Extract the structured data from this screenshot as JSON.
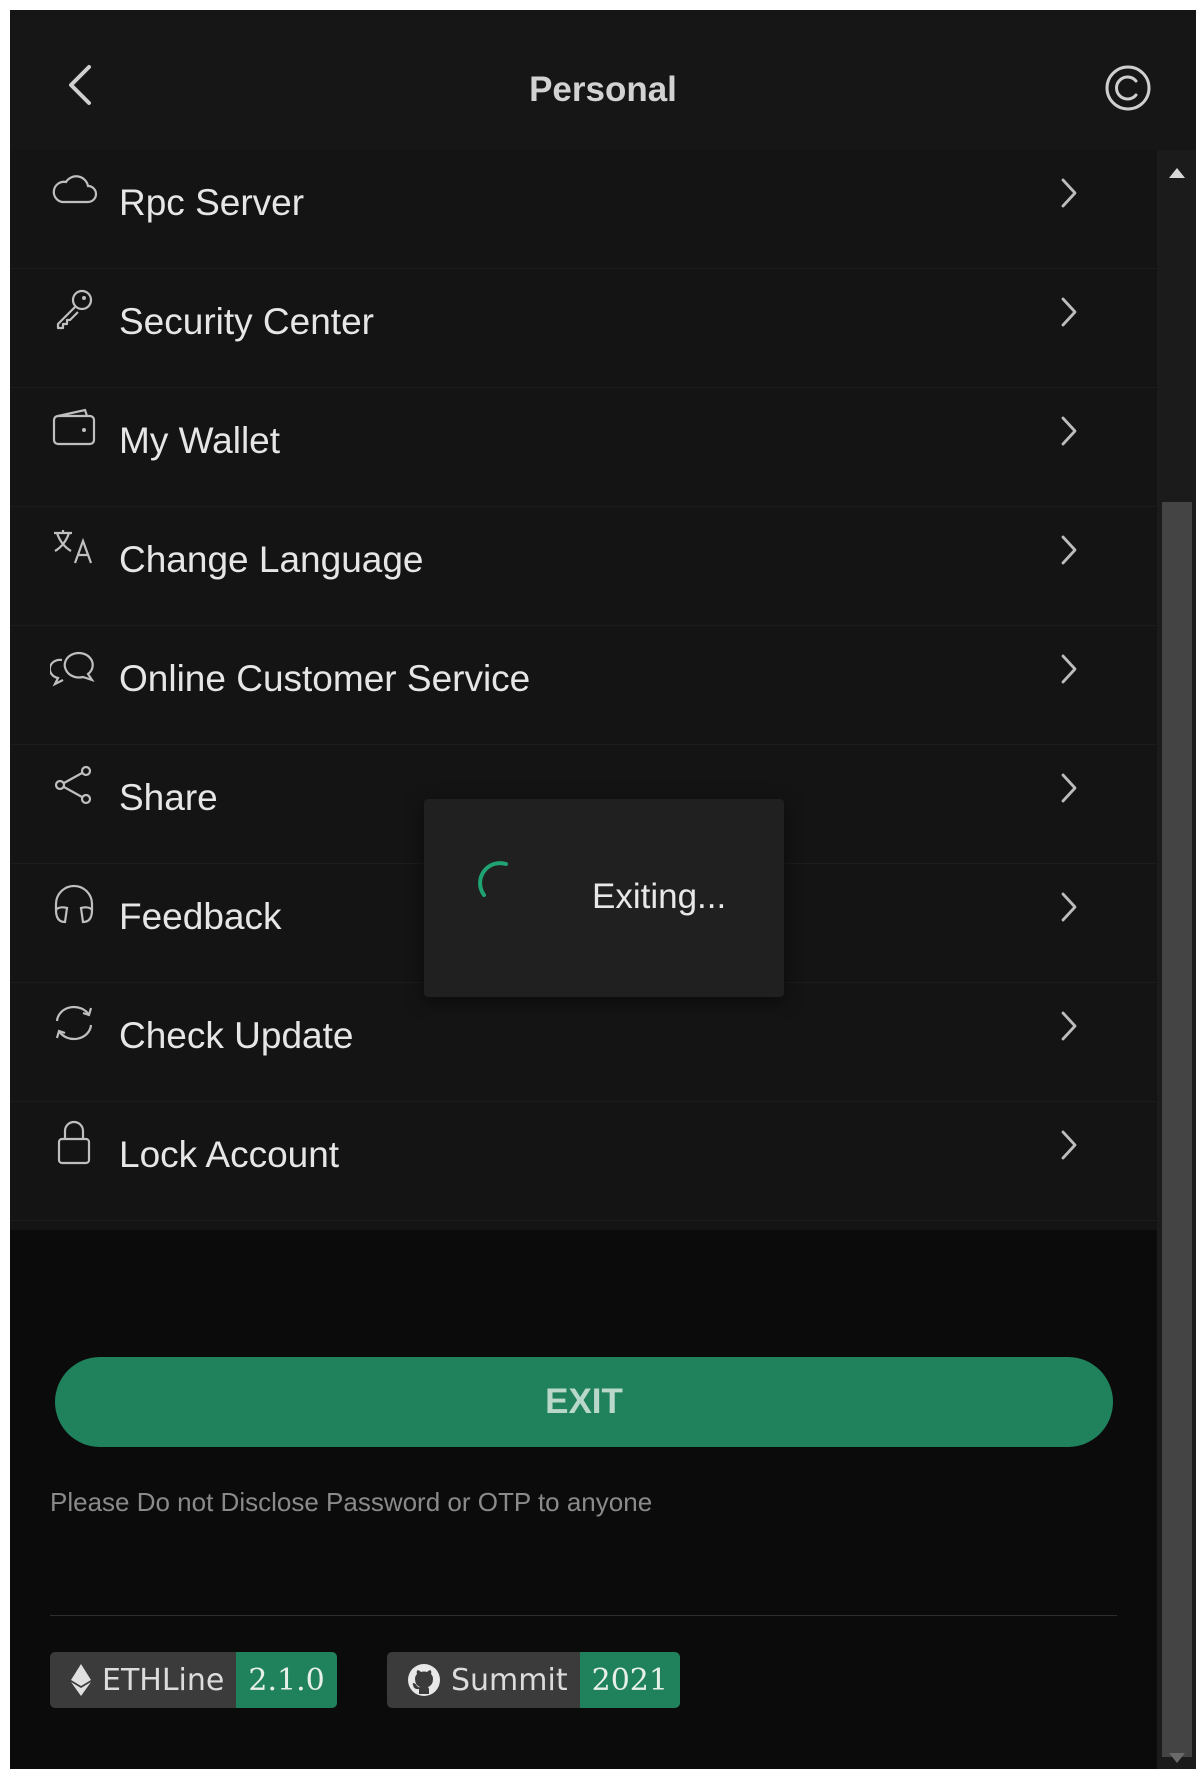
{
  "header": {
    "title": "Personal",
    "back_icon": "chevron-left-icon",
    "refresh_icon": "copyright-refresh-icon"
  },
  "menu": {
    "items": [
      {
        "label": "Rpc Server",
        "icon": "cloud-icon"
      },
      {
        "label": "Security Center",
        "icon": "key-icon"
      },
      {
        "label": "My Wallet",
        "icon": "wallet-icon"
      },
      {
        "label": "Change Language",
        "icon": "translate-icon"
      },
      {
        "label": "Online Customer Service",
        "icon": "chat-bubbles-icon"
      },
      {
        "label": "Share",
        "icon": "share-icon"
      },
      {
        "label": "Feedback",
        "icon": "headphones-icon"
      },
      {
        "label": "Check Update",
        "icon": "sync-icon"
      },
      {
        "label": "Lock Account",
        "icon": "lock-icon"
      }
    ]
  },
  "exit_button": {
    "label": "EXIT"
  },
  "warning": {
    "text": "Please Do not Disclose Password or OTP to anyone"
  },
  "badges": [
    {
      "name": "ETHLine",
      "value": "2.1.0",
      "icon": "ethereum-icon"
    },
    {
      "name": "Summit",
      "value": "2021",
      "icon": "github-icon"
    }
  ],
  "toast": {
    "text": "Exiting..."
  },
  "colors": {
    "accent": "#20825c",
    "background": "#0b0b0b",
    "panel": "#141414",
    "spinner": "#1fa373"
  }
}
